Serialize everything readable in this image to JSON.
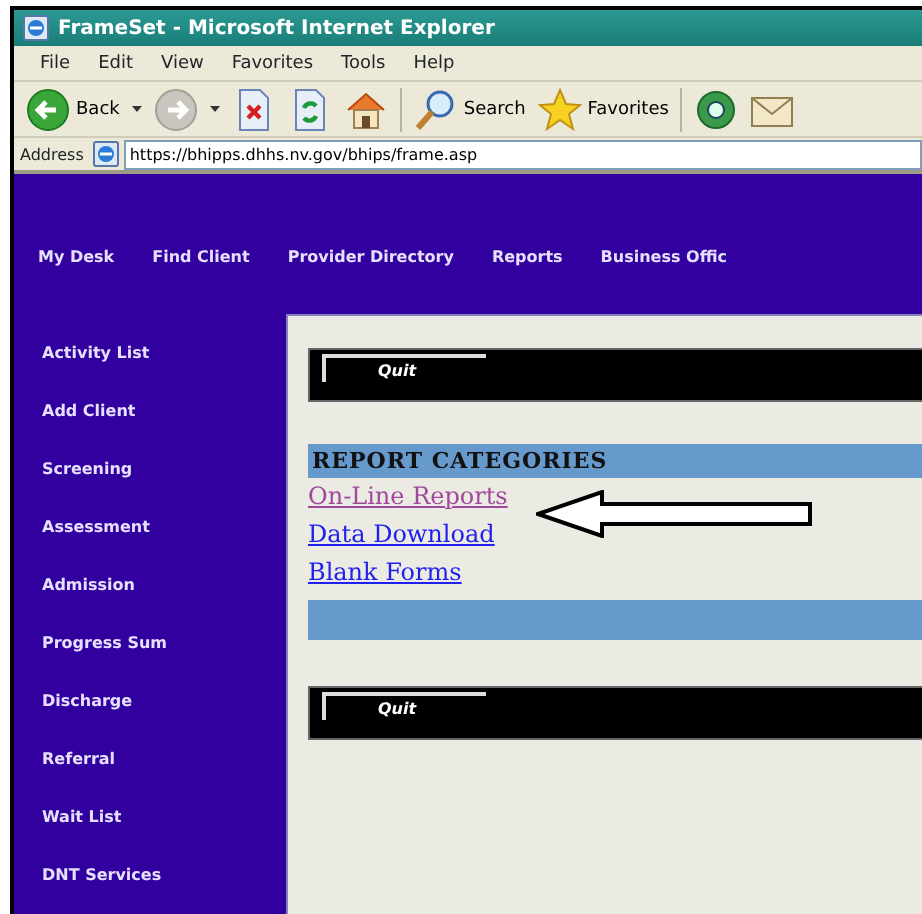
{
  "window": {
    "title": "FrameSet - Microsoft Internet Explorer"
  },
  "menu": [
    "File",
    "Edit",
    "View",
    "Favorites",
    "Tools",
    "Help"
  ],
  "toolbar": [
    {
      "kind": "back",
      "label": "Back"
    },
    {
      "kind": "forward"
    },
    {
      "kind": "stop"
    },
    {
      "kind": "refresh"
    },
    {
      "kind": "home"
    },
    {
      "kind": "search",
      "label": "Search"
    },
    {
      "kind": "favorites",
      "label": "Favorites"
    },
    {
      "kind": "media"
    },
    {
      "kind": "mail"
    }
  ],
  "address": {
    "label": "Address",
    "value": "https://bhipps.dhhs.nv.gov/bhips/frame.asp"
  },
  "top_nav": [
    "My Desk",
    "Find Client",
    "Provider Directory",
    "Reports",
    "Business Offic"
  ],
  "sidebar": [
    "Activity List",
    "Add Client",
    "Screening",
    "Assessment",
    "Admission",
    "Progress Sum",
    "Discharge",
    "Referral",
    "Wait List",
    "DNT Services"
  ],
  "content": [
    {
      "kind": "quit",
      "label": "Quit"
    },
    {
      "kind": "heading",
      "text": "REPORT CATEGORIES"
    },
    {
      "kind": "link",
      "text": "On-Line Reports",
      "visited": true
    },
    {
      "kind": "link",
      "text": "Data Download",
      "visited": false
    },
    {
      "kind": "link",
      "text": "Blank Forms",
      "visited": false
    },
    {
      "kind": "band"
    },
    {
      "kind": "quit",
      "label": "Quit"
    }
  ]
}
